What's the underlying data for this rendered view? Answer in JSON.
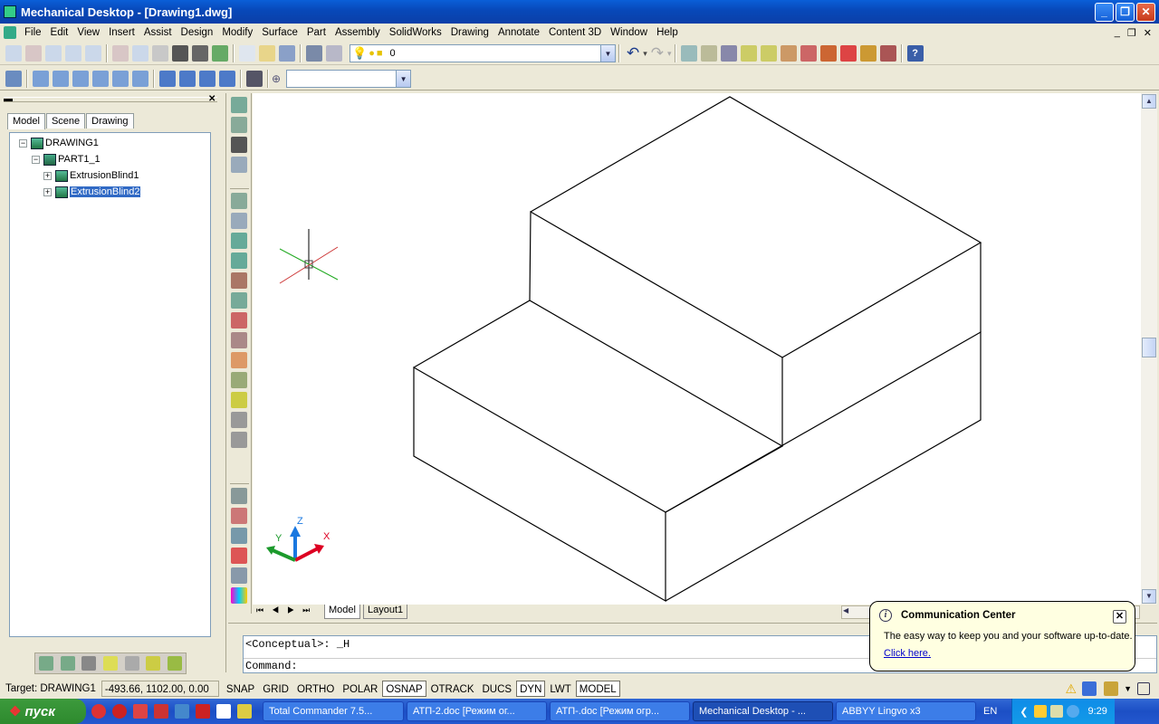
{
  "window": {
    "title": "Mechanical Desktop - [Drawing1.dwg]"
  },
  "menu": [
    "File",
    "Edit",
    "View",
    "Insert",
    "Assist",
    "Design",
    "Modify",
    "Surface",
    "Part",
    "Assembly",
    "SolidWorks",
    "Drawing",
    "Annotate",
    "Content 3D",
    "Window",
    "Help"
  ],
  "layer_combo": {
    "value": "0"
  },
  "panel_tabs": [
    "Model",
    "Scene",
    "Drawing"
  ],
  "tree": {
    "root": "DRAWING1",
    "part": "PART1_1",
    "features": [
      "ExtrusionBlind1",
      "ExtrusionBlind2"
    ]
  },
  "layout_tabs": [
    "Model",
    "Layout1"
  ],
  "axes": {
    "x": "X",
    "y": "Y",
    "z": "Z"
  },
  "command": {
    "line1": "<Conceptual>: _H",
    "line2": "Command:"
  },
  "status": {
    "target": "Target: DRAWING1",
    "coords": "-493.66, 1102.00, 0.00",
    "buttons": [
      "SNAP",
      "GRID",
      "ORTHO",
      "POLAR",
      "OSNAP",
      "OTRACK",
      "DUCS",
      "DYN",
      "LWT",
      "MODEL"
    ],
    "on_buttons": [
      "OSNAP",
      "DYN",
      "MODEL"
    ]
  },
  "balloon": {
    "title": "Communication Center",
    "text": "The easy way to keep you and your software up-to-date.",
    "link": "Click here."
  },
  "taskbar": {
    "start": "пуск",
    "tasks": [
      "Total Commander 7.5...",
      "АТП-2.doc [Режим ог...",
      "АТП-.doc [Режим огр...",
      "Mechanical Desktop - ...",
      "ABBYY Lingvo x3"
    ],
    "active_task": "Mechanical Desktop - ...",
    "lang": "EN",
    "clock": "9:29"
  }
}
